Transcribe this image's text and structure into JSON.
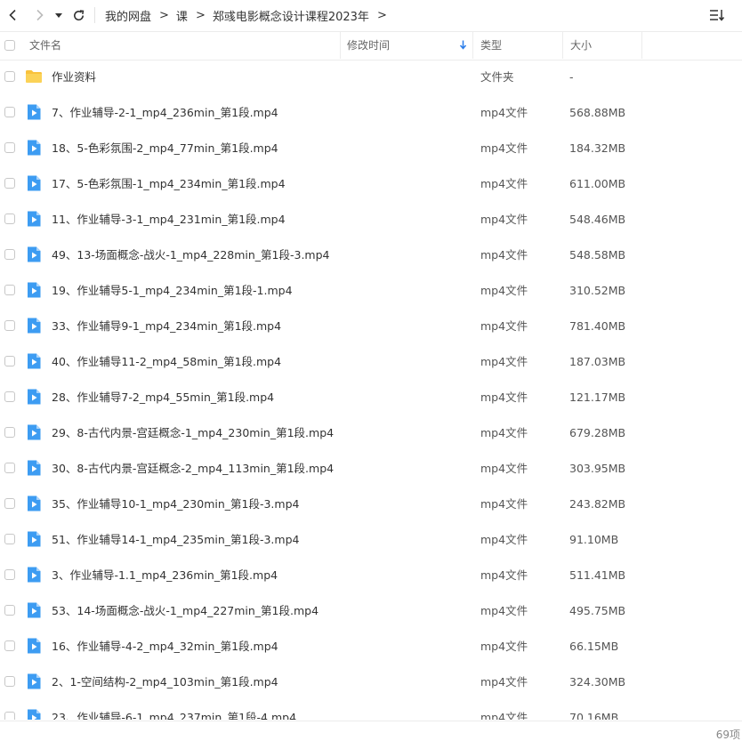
{
  "toolbar": {
    "breadcrumb": [
      "我的网盘",
      "课",
      "郑彧电影概念设计课程2023年"
    ],
    "separator": ">"
  },
  "columns": {
    "name": "文件名",
    "modified": "修改时间",
    "type": "类型",
    "size": "大小"
  },
  "files": [
    {
      "name": "作业资料",
      "type": "文件夹",
      "size": "-",
      "icon": "folder-icon"
    },
    {
      "name": "7、作业辅导-2-1_mp4_236min_第1段.mp4",
      "type": "mp4文件",
      "size": "568.88MB",
      "icon": "video-file-icon"
    },
    {
      "name": "18、5-色彩氛围-2_mp4_77min_第1段.mp4",
      "type": "mp4文件",
      "size": "184.32MB",
      "icon": "video-file-icon"
    },
    {
      "name": "17、5-色彩氛围-1_mp4_234min_第1段.mp4",
      "type": "mp4文件",
      "size": "611.00MB",
      "icon": "video-file-icon"
    },
    {
      "name": "11、作业辅导-3-1_mp4_231min_第1段.mp4",
      "type": "mp4文件",
      "size": "548.46MB",
      "icon": "video-file-icon"
    },
    {
      "name": "49、13-场面概念-战火-1_mp4_228min_第1段-3.mp4",
      "type": "mp4文件",
      "size": "548.58MB",
      "icon": "video-file-icon"
    },
    {
      "name": "19、作业辅导5-1_mp4_234min_第1段-1.mp4",
      "type": "mp4文件",
      "size": "310.52MB",
      "icon": "video-file-icon"
    },
    {
      "name": "33、作业辅导9-1_mp4_234min_第1段.mp4",
      "type": "mp4文件",
      "size": "781.40MB",
      "icon": "video-file-icon"
    },
    {
      "name": "40、作业辅导11-2_mp4_58min_第1段.mp4",
      "type": "mp4文件",
      "size": "187.03MB",
      "icon": "video-file-icon"
    },
    {
      "name": "28、作业辅导7-2_mp4_55min_第1段.mp4",
      "type": "mp4文件",
      "size": "121.17MB",
      "icon": "video-file-icon"
    },
    {
      "name": "29、8-古代内景-宫廷概念-1_mp4_230min_第1段.mp4",
      "type": "mp4文件",
      "size": "679.28MB",
      "icon": "video-file-icon"
    },
    {
      "name": "30、8-古代内景-宫廷概念-2_mp4_113min_第1段.mp4",
      "type": "mp4文件",
      "size": "303.95MB",
      "icon": "video-file-icon"
    },
    {
      "name": "35、作业辅导10-1_mp4_230min_第1段-3.mp4",
      "type": "mp4文件",
      "size": "243.82MB",
      "icon": "video-file-icon"
    },
    {
      "name": "51、作业辅导14-1_mp4_235min_第1段-3.mp4",
      "type": "mp4文件",
      "size": "91.10MB",
      "icon": "video-file-icon"
    },
    {
      "name": "3、作业辅导-1.1_mp4_236min_第1段.mp4",
      "type": "mp4文件",
      "size": "511.41MB",
      "icon": "video-file-icon"
    },
    {
      "name": "53、14-场面概念-战火-1_mp4_227min_第1段.mp4",
      "type": "mp4文件",
      "size": "495.75MB",
      "icon": "video-file-icon"
    },
    {
      "name": "16、作业辅导-4-2_mp4_32min_第1段.mp4",
      "type": "mp4文件",
      "size": "66.15MB",
      "icon": "video-file-icon"
    },
    {
      "name": "2、1-空间结构-2_mp4_103min_第1段.mp4",
      "type": "mp4文件",
      "size": "324.30MB",
      "icon": "video-file-icon"
    },
    {
      "name": "23、作业辅导-6-1_mp4_237min_第1段-4.mp4",
      "type": "mp4文件",
      "size": "70.16MB",
      "icon": "video-file-icon"
    }
  ],
  "status": {
    "item_count": "69项"
  },
  "colors": {
    "folder": "#f9c23c",
    "video_icon": "#3d9cf2",
    "sort_accent": "#2b7de9",
    "divider": "#ececec"
  }
}
